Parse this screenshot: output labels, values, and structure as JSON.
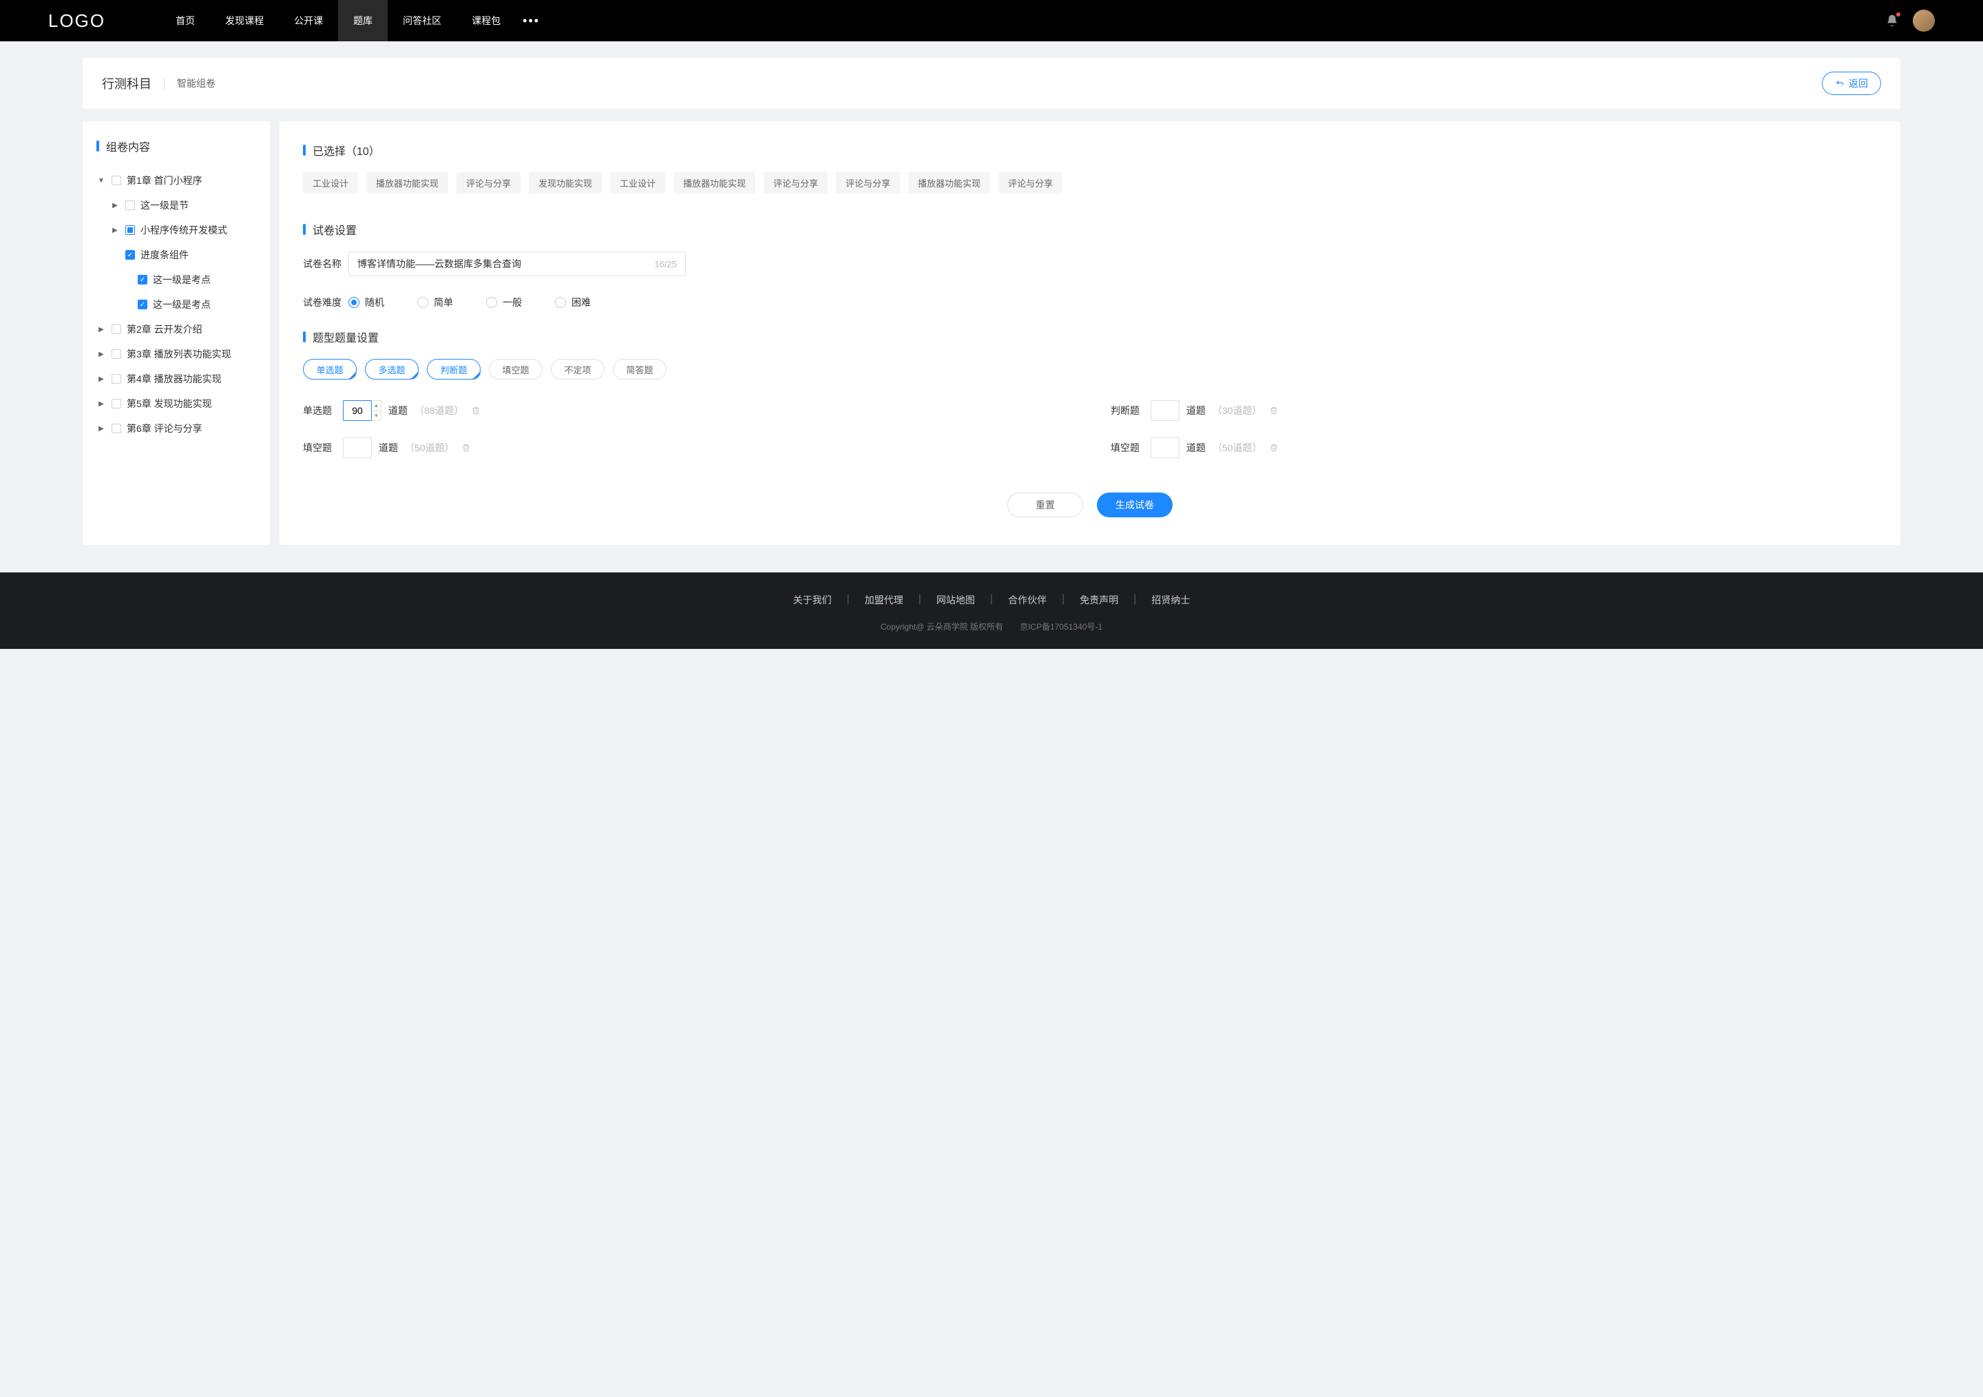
{
  "nav": {
    "logo": "LOGO",
    "items": [
      "首页",
      "发现课程",
      "公开课",
      "题库",
      "问答社区",
      "课程包"
    ],
    "activeIndex": 3,
    "more": "•••"
  },
  "header": {
    "title": "行测科目",
    "subtitle": "智能组卷",
    "back": "返回"
  },
  "sidebar": {
    "title": "组卷内容",
    "tree": [
      {
        "level": 1,
        "caret": "▼",
        "cb": "",
        "label": "第1章 首门小程序"
      },
      {
        "level": 2,
        "caret": "▶",
        "cb": "",
        "label": "这一级是节"
      },
      {
        "level": 2,
        "caret": "▶",
        "cb": "semi",
        "label": "小程序传统开发模式"
      },
      {
        "level": 2,
        "caret": "",
        "cb": "checked",
        "label": "进度条组件"
      },
      {
        "level": 3,
        "caret": "",
        "cb": "checked",
        "label": "这一级是考点"
      },
      {
        "level": 3,
        "caret": "",
        "cb": "checked",
        "label": "这一级是考点"
      },
      {
        "level": 1,
        "caret": "▶",
        "cb": "",
        "label": "第2章 云开发介绍"
      },
      {
        "level": 1,
        "caret": "▶",
        "cb": "",
        "label": "第3章 播放列表功能实现"
      },
      {
        "level": 1,
        "caret": "▶",
        "cb": "",
        "label": "第4章 播放器功能实现"
      },
      {
        "level": 1,
        "caret": "▶",
        "cb": "",
        "label": "第5章 发现功能实现"
      },
      {
        "level": 1,
        "caret": "▶",
        "cb": "",
        "label": "第6章 评论与分享"
      }
    ]
  },
  "selected": {
    "title": "已选择（10）",
    "tags": [
      "工业设计",
      "播放器功能实现",
      "评论与分享",
      "发现功能实现",
      "工业设计",
      "播放器功能实现",
      "评论与分享",
      "评论与分享",
      "播放器功能实现",
      "评论与分享"
    ]
  },
  "settings": {
    "title": "试卷设置",
    "nameLabel": "试卷名称",
    "nameValue": "博客详情功能——云数据库多集合查询",
    "nameCounter": "16/25",
    "diffLabel": "试卷难度",
    "diffOptions": [
      "随机",
      "简单",
      "一般",
      "困难"
    ],
    "diffActive": 0
  },
  "typeSettings": {
    "title": "题型题量设置",
    "types": [
      {
        "label": "单选题",
        "active": true
      },
      {
        "label": "多选题",
        "active": true
      },
      {
        "label": "判断题",
        "active": true
      },
      {
        "label": "填空题",
        "active": false
      },
      {
        "label": "不定项",
        "active": false
      },
      {
        "label": "简答题",
        "active": false
      }
    ],
    "qty": [
      {
        "label": "单选题",
        "value": "90",
        "unit": "道题",
        "hint": "（88道题）",
        "focused": true,
        "spinner": true
      },
      {
        "label": "判断题",
        "value": "",
        "unit": "道题",
        "hint": "（30道题）"
      },
      {
        "label": "填空题",
        "value": "",
        "unit": "道题",
        "hint": "（50道题）"
      },
      {
        "label": "填空题",
        "value": "",
        "unit": "道题",
        "hint": "（50道题）"
      }
    ]
  },
  "actions": {
    "reset": "重置",
    "submit": "生成试卷"
  },
  "footer": {
    "links": [
      "关于我们",
      "加盟代理",
      "网站地图",
      "合作伙伴",
      "免责声明",
      "招贤纳士"
    ],
    "copyright": "Copyright@ 云朵商学院   版权所有",
    "icp": "京ICP备17051340号-1"
  }
}
